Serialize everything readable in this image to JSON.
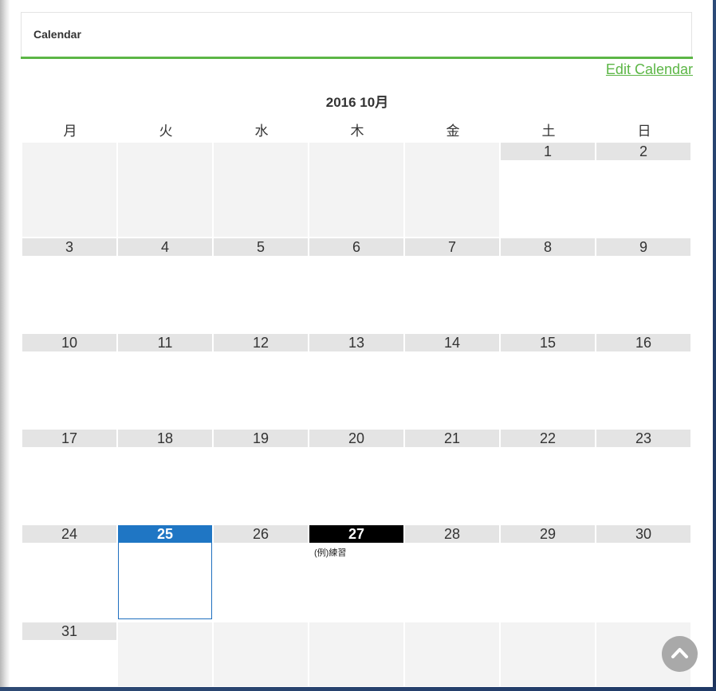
{
  "widget": {
    "title": "Calendar",
    "edit_link": "Edit Calendar"
  },
  "calendar": {
    "month_title": "2016 10月",
    "weekdays": [
      "月",
      "火",
      "水",
      "木",
      "金",
      "土",
      "日"
    ],
    "days": [
      "1",
      "2",
      "3",
      "4",
      "5",
      "6",
      "7",
      "8",
      "9",
      "10",
      "11",
      "12",
      "13",
      "14",
      "15",
      "16",
      "17",
      "18",
      "19",
      "20",
      "21",
      "22",
      "23",
      "24",
      "25",
      "26",
      "27",
      "28",
      "29",
      "30",
      "31"
    ],
    "today": "25",
    "events": [
      {
        "day": "27",
        "label": "(例)練習"
      }
    ]
  },
  "colors": {
    "accent_green": "#5cb646",
    "today_blue": "#1f76c4",
    "event_day_black": "#000000",
    "header_gray": "#e4e4e4",
    "empty_cell_gray": "#f3f3f3"
  },
  "icons": {
    "scroll_top": "chevron-up-icon"
  }
}
